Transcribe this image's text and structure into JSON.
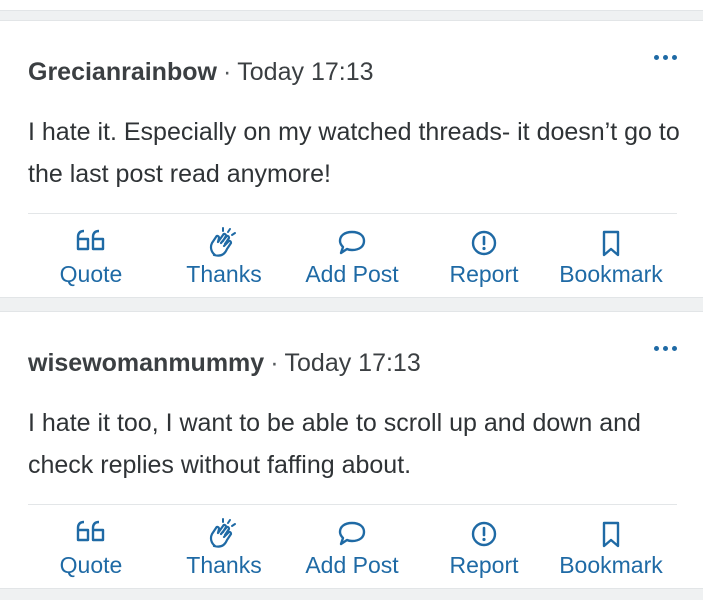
{
  "posts": [
    {
      "author": "Grecianrainbow",
      "separator": "·",
      "time": "Today 17:13",
      "body": "I hate it. Especially on my watched threads- it doesn’t go to the last post read anymore!",
      "actions": {
        "quote": "Quote",
        "thanks": "Thanks",
        "add_post": "Add Post",
        "report": "Report",
        "bookmark": "Bookmark"
      }
    },
    {
      "author": "wisewomanmummy",
      "separator": "·",
      "time": "Today 17:13",
      "body": "I hate it too, I want to be able to scroll up and down and check replies without faffing about.",
      "actions": {
        "quote": "Quote",
        "thanks": "Thanks",
        "add_post": "Add Post",
        "report": "Report",
        "bookmark": "Bookmark"
      }
    }
  ],
  "icons": {
    "quote": "quote-icon",
    "thanks": "clapping-hands-icon",
    "add_post": "speech-bubble-icon",
    "report": "exclamation-circle-icon",
    "bookmark": "bookmark-icon",
    "more": "more-options-icon"
  },
  "colors": {
    "accent": "#1f6aa5",
    "background": "#eff1f2",
    "card": "#ffffff",
    "text": "#2f3336"
  }
}
